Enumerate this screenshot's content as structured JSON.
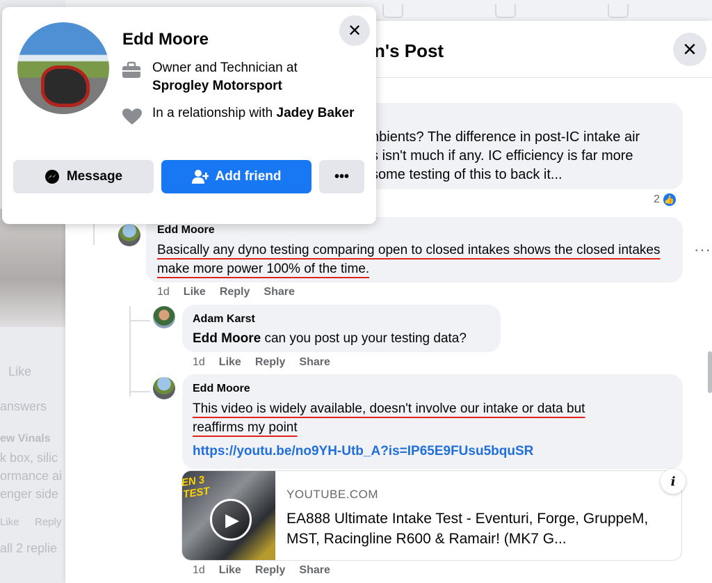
{
  "background": {
    "like": "Like",
    "answers": "answers",
    "name_fragment": "ew Vinals",
    "lines": [
      "k box, silic",
      "ormance ai",
      "enger side"
    ],
    "actions": [
      "Like",
      "Reply"
    ],
    "replies": "all 2 replie"
  },
  "post": {
    "title": "n's Post",
    "prior_comment": {
      "text": "                  nbients? The difference in post-IC intake air\n                  s isn't much if any. IC efficiency is far more\n                  some testing of this to back it...",
      "reaction_count": "2"
    },
    "comments": [
      {
        "author": "Edd Moore",
        "text": "Basically any dyno testing comparing open to closed intakes shows the closed intakes make more power 100% of the time.",
        "time": "1d",
        "like": "Like",
        "reply": "Reply",
        "share": "Share"
      },
      {
        "author": "Adam Karst",
        "mention": "Edd Moore",
        "text": " can you post up your testing data?",
        "time": "1d",
        "like": "Like",
        "reply": "Reply",
        "share": "Share"
      },
      {
        "author": "Edd Moore",
        "text": "This video is widely available, doesn't involve our intake or data but reaffirms my point",
        "link": "https://youtu.be/no9YH-Utb_A?is=IP65E9FUsu5bquSR",
        "time": "1d",
        "like": "Like",
        "reply": "Reply",
        "share": "Share"
      }
    ],
    "link_preview": {
      "domain": "YOUTUBE.COM",
      "title": "EA888 Ultimate Intake Test - Eventuri, Forge, GruppeM, MST, Racingline R600 & Ramair! (MK7 G...",
      "thumb_text": "EN 3\nTEST"
    }
  },
  "hover_card": {
    "name": "Edd Moore",
    "work_prefix": "Owner and Technician at",
    "work_place": "Sprogley Motorsport",
    "relationship_prefix": "In a relationship with",
    "relationship_name": "Jadey Baker",
    "message_label": "Message",
    "add_friend_label": "Add friend",
    "more_label": "•••"
  },
  "icons": {
    "close": "✕",
    "briefcase": "briefcase-icon",
    "heart": "heart-icon",
    "messenger": "messenger-icon",
    "add_person": "add-person-icon",
    "play": "▶",
    "info": "i",
    "like_thumb": "👍"
  },
  "colors": {
    "accent": "#1877f2",
    "link": "#216fdb",
    "underline": "#e0241c"
  }
}
